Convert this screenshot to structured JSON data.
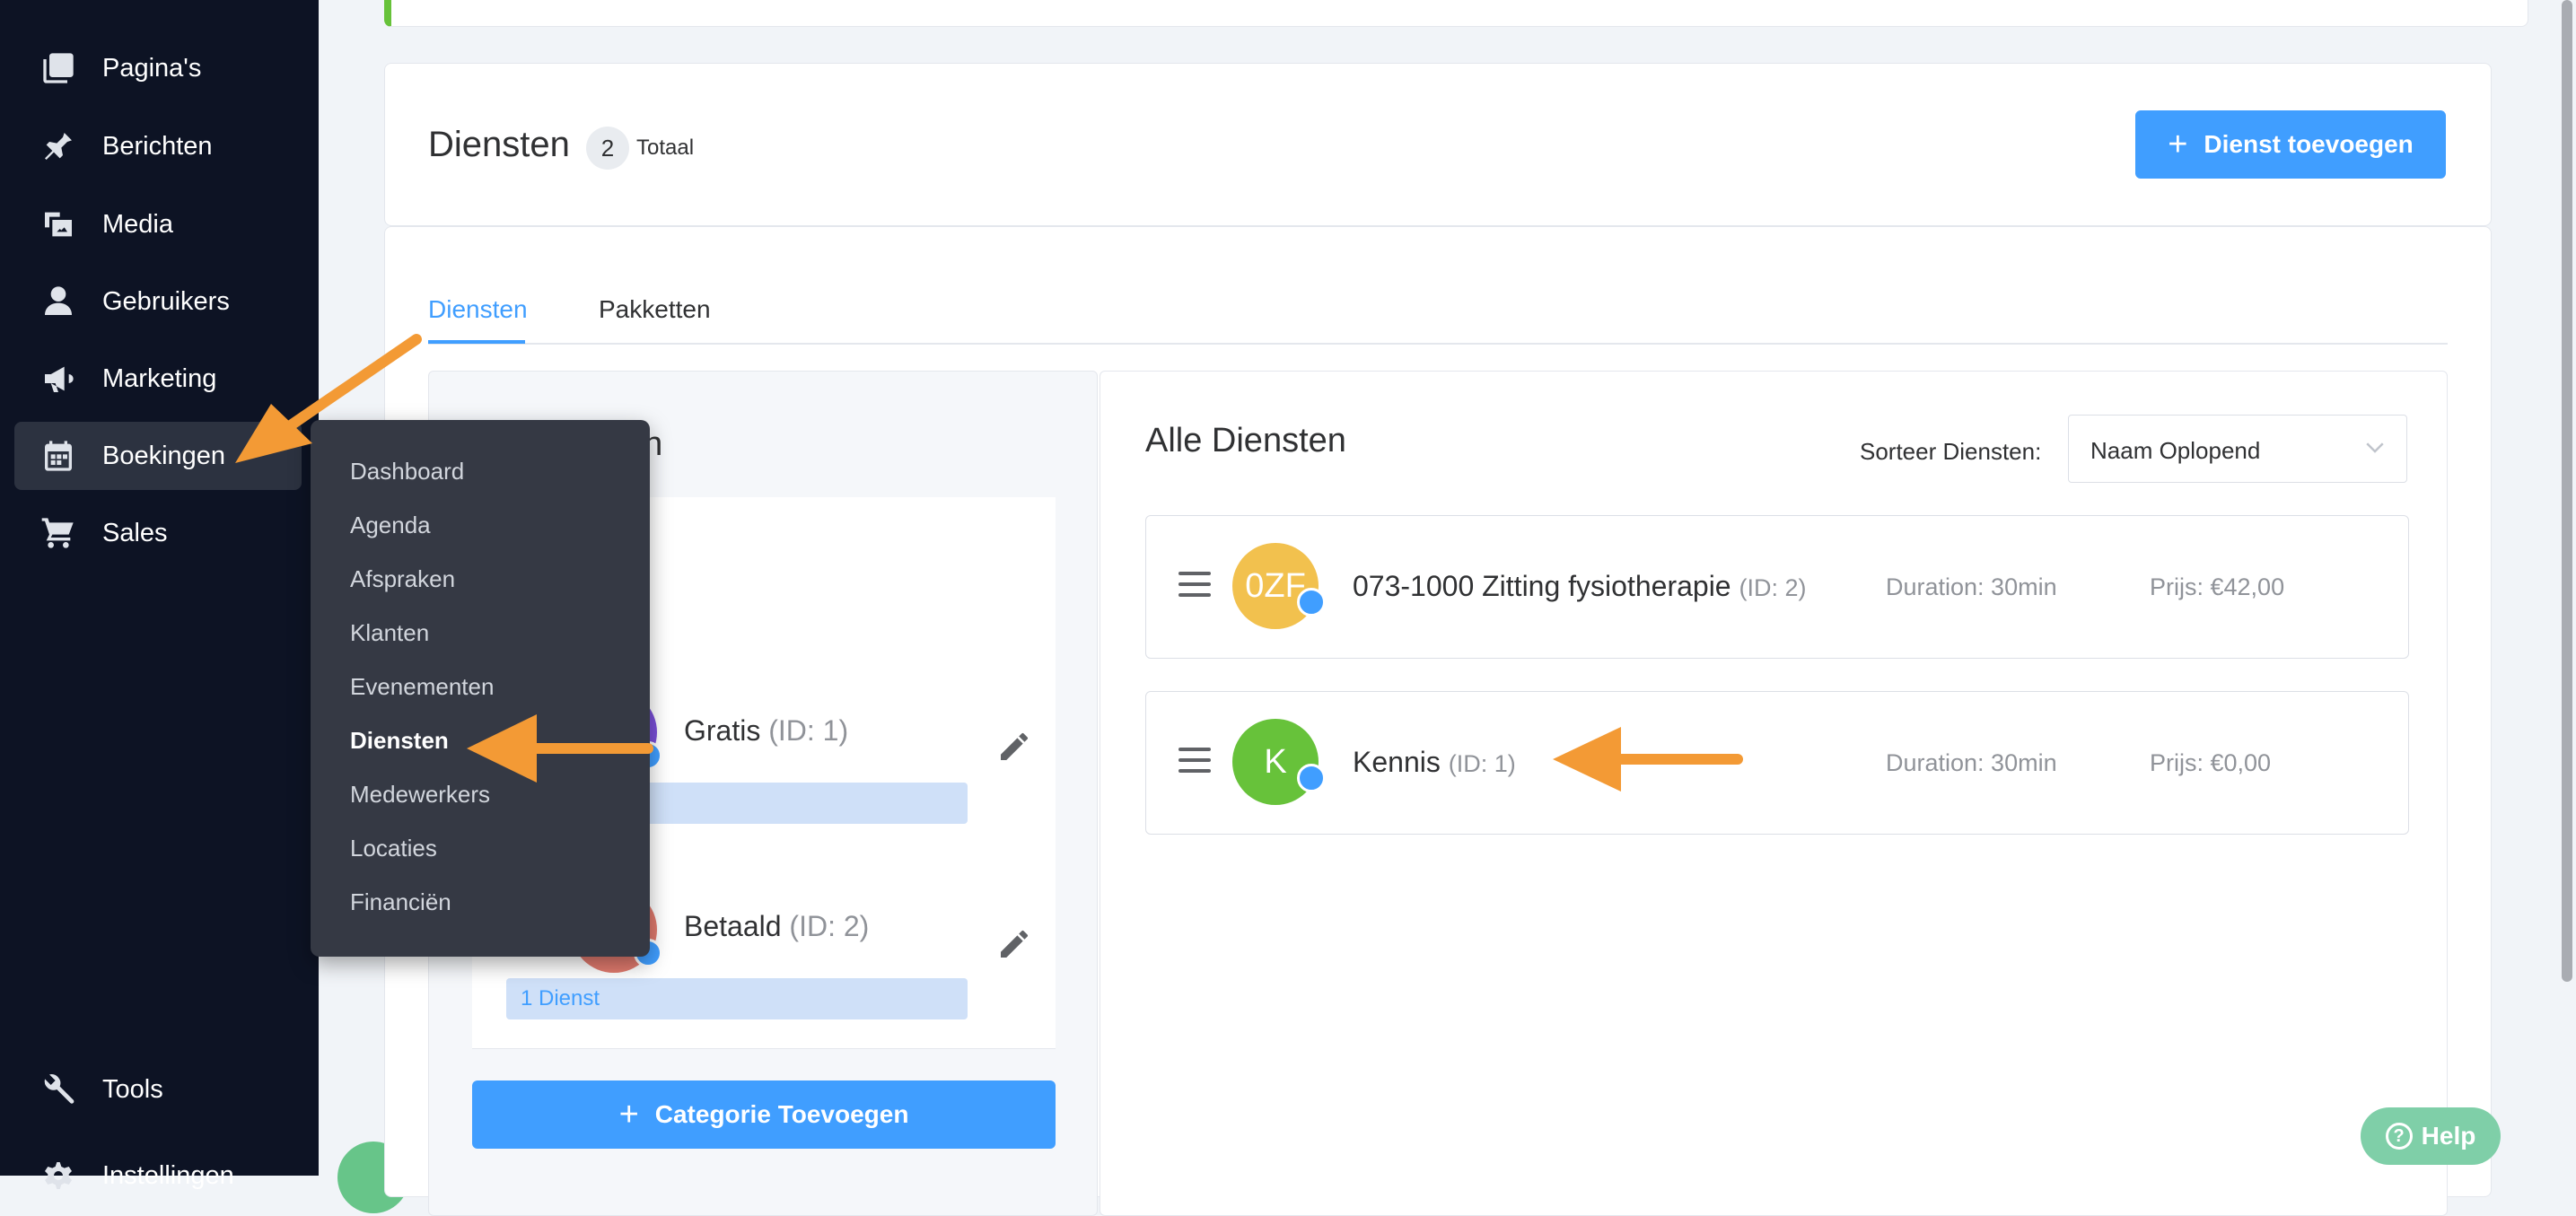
{
  "sidebar": {
    "items": [
      {
        "label": "Pagina's",
        "icon": "pages-icon"
      },
      {
        "label": "Berichten",
        "icon": "pin-icon"
      },
      {
        "label": "Media",
        "icon": "media-icon"
      },
      {
        "label": "Gebruikers",
        "icon": "user-icon"
      },
      {
        "label": "Marketing",
        "icon": "megaphone-icon"
      },
      {
        "label": "Boekingen",
        "icon": "calendar-icon"
      },
      {
        "label": "Sales",
        "icon": "cart-icon"
      },
      {
        "label": "Tools",
        "icon": "wrench-icon"
      },
      {
        "label": "Instellingen",
        "icon": "settings-icon"
      }
    ],
    "active": "Boekingen"
  },
  "submenu": {
    "items": [
      "Dashboard",
      "Agenda",
      "Afspraken",
      "Klanten",
      "Evenementen",
      "Diensten",
      "Medewerkers",
      "Locaties",
      "Financiën"
    ],
    "active": "Diensten"
  },
  "header": {
    "title": "Diensten",
    "count": "2",
    "count_label": "Totaal",
    "add_button": "Dienst toevoegen"
  },
  "tabs": [
    {
      "label": "Diensten",
      "active": true
    },
    {
      "label": "Pakketten",
      "active": false
    }
  ],
  "categories": {
    "header_visible": "en",
    "all_item_visible": "en",
    "items": [
      {
        "name": "Gratis",
        "id": "(ID: 1)",
        "tag": ""
      },
      {
        "name": "Betaald",
        "id": "(ID: 2)",
        "tag": "1 Dienst"
      }
    ],
    "add_button": "Categorie Toevoegen"
  },
  "services": {
    "title": "Alle Diensten",
    "sort_label": "Sorteer Diensten:",
    "sort_value": "Naam Oplopend",
    "items": [
      {
        "avatar": "0ZF",
        "name": "073-1000 Zitting fysiotherapie",
        "id": "(ID: 2)",
        "duration": "Duration: 30min",
        "price": "Prijs: €42,00",
        "color": "#f2c14e"
      },
      {
        "avatar": "K",
        "name": "Kennis",
        "id": "(ID: 1)",
        "duration": "Duration: 30min",
        "price": "Prijs: €0,00",
        "color": "#67c23a"
      }
    ]
  },
  "help": {
    "label": "Help"
  },
  "colors": {
    "accent": "#409eff",
    "annotation_arrow": "#f39a35",
    "sidebar_bg": "#0d1324"
  }
}
